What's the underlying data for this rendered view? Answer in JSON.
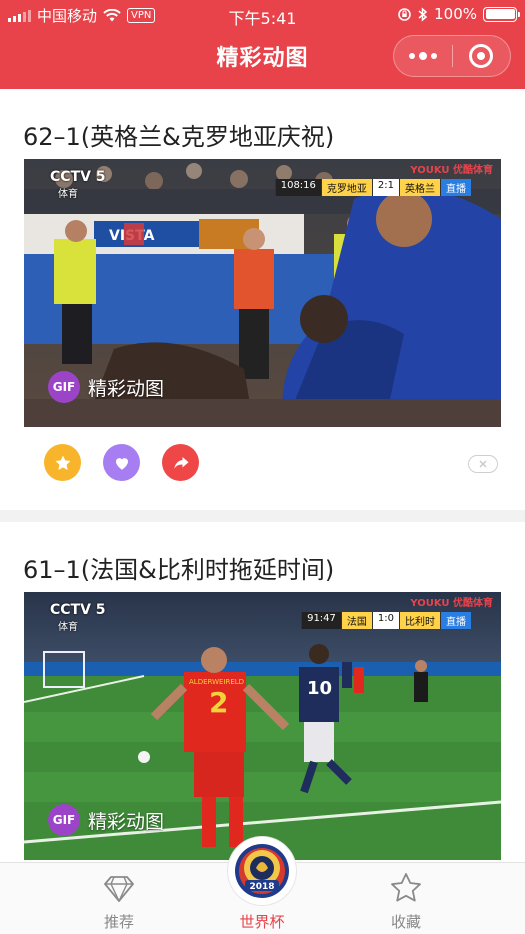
{
  "status_bar": {
    "carrier": "中国移动",
    "vpn": "VPN",
    "time": "下午5:41",
    "battery": "100%"
  },
  "nav": {
    "title": "精彩动图"
  },
  "posts": [
    {
      "title": "62–1(英格兰&克罗地亚庆祝)",
      "gif_badge": "GIF",
      "gif_label": "精彩动图",
      "broadcaster": "CCTV 5",
      "broadcaster_sub": "体育",
      "scoreboard": {
        "time": "108:16",
        "home": "克罗地亚",
        "score": "2:1",
        "away": "英格兰",
        "status": "直播"
      },
      "watermark": "YOUKU 优酷体育"
    },
    {
      "title": "61–1(法国&比利时拖延时间)",
      "gif_badge": "GIF",
      "gif_label": "精彩动图",
      "broadcaster": "CCTV 5",
      "broadcaster_sub": "体育",
      "scoreboard": {
        "time": "91:47",
        "home": "法国",
        "score": "1:0",
        "away": "比利时",
        "status": "直播"
      },
      "watermark": "YOUKU 优酷体育",
      "player_name": "ALDERWEIRELD",
      "player_number_red": "2",
      "player_number_blue": "10"
    }
  ],
  "tabbar": {
    "items": [
      {
        "label": "推荐",
        "icon": "diamond-icon",
        "active": false
      },
      {
        "label": "世界杯",
        "icon": "world-cup-2018-logo",
        "active": true,
        "logo_year": "2018"
      },
      {
        "label": "收藏",
        "icon": "star-outline-icon",
        "active": false
      }
    ]
  },
  "colors": {
    "brand": "#e8434a",
    "favorite": "#f8b52b",
    "like": "#a77ef1",
    "share": "#ef4747",
    "gif_badge": "#9b44c8"
  }
}
